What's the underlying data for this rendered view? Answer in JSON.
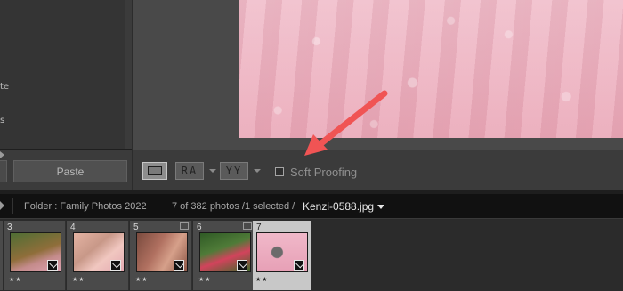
{
  "left_panel": {
    "text_fragments": [
      "te",
      "s"
    ],
    "paste_label": "Paste"
  },
  "toolbar": {
    "ra_label": "RA",
    "yy_label": "YY",
    "soft_proofing_label": "Soft Proofing",
    "soft_proofing_checked": false
  },
  "filmstrip_header": {
    "folder_text": "Folder : Family Photos 2022",
    "count_text": "7 of 382 photos /1 selected /",
    "filename": "Kenzi-0588.jpg"
  },
  "filmstrip": {
    "items": [
      {
        "number": "3",
        "stars": "★★",
        "selected": false
      },
      {
        "number": "4",
        "stars": "★★",
        "selected": false
      },
      {
        "number": "5",
        "stars": "★★",
        "selected": false
      },
      {
        "number": "6",
        "stars": "★★",
        "selected": false
      },
      {
        "number": "7",
        "stars": "★★",
        "selected": true
      }
    ]
  },
  "icons": {
    "view_mode": "loupe-view-icon",
    "arrow": "annotation-arrow-icon"
  },
  "colors": {
    "arrow": "#f05454",
    "panel_bg": "#3b3b3b",
    "header_bg": "#111111"
  }
}
